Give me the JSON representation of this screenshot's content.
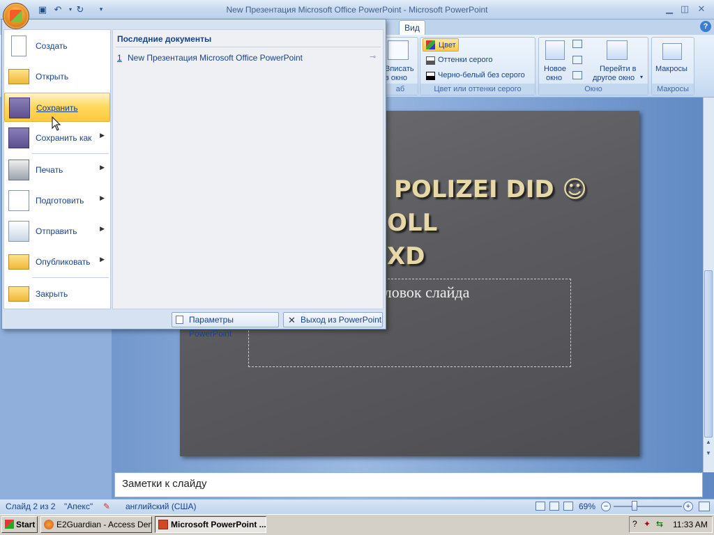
{
  "window": {
    "title": "New Презентация Microsoft Office PowerPoint - Microsoft PowerPoint"
  },
  "ribbon": {
    "tab_view": "Вид",
    "fit_window_line1": "Вписать",
    "fit_window_line2": "в окно",
    "scale_group_label": "аб",
    "color_button": "Цвет",
    "grayscale_button": "Оттенки серого",
    "bw_button": "Черно-белый без серого",
    "color_group_label": "Цвет или оттенки серого",
    "new_window_line1": "Новое",
    "new_window_line2": "окно",
    "switch_window_line1": "Перейти в",
    "switch_window_line2": "другое окно",
    "window_group_label": "Окно",
    "macros_button": "Макросы",
    "macros_group_label": "Макросы"
  },
  "menu": {
    "recent_header": "Последние документы",
    "recent_items": [
      {
        "number": "1",
        "name": "New Презентация Microsoft Office PowerPoint"
      }
    ],
    "items": [
      {
        "label": "Создать"
      },
      {
        "label": "Открыть"
      },
      {
        "label": "Сохранить"
      },
      {
        "label": "Сохранить как"
      },
      {
        "label": "Печать"
      },
      {
        "label": "Подготовить"
      },
      {
        "label": "Отправить"
      },
      {
        "label": "Опубликовать"
      },
      {
        "label": "Закрыть"
      }
    ],
    "options_button": "Параметры PowerPoint",
    "exit_button": "Выход из PowerPoint"
  },
  "slide": {
    "title_line1": "POLIZEI DID ☺",
    "title_line2": "OLL",
    "title_line3": "XD",
    "subtitle_placeholder": "оловок слайда"
  },
  "notes": {
    "placeholder": "Заметки к слайду"
  },
  "status": {
    "slide_counter": "Слайд 2 из 2",
    "theme": "\"Апекс\"",
    "language": "английский (США)",
    "zoom": "69%"
  },
  "taskbar": {
    "start": "Start",
    "tasks": [
      {
        "label": "E2Guardian - Access Den..."
      },
      {
        "label": "Microsoft PowerPoint ..."
      }
    ],
    "clock": "11:33 AM"
  },
  "colors": {
    "office_orange": "#e68a1c",
    "menu_hover": "#ffd75a",
    "ribbon_text": "#15428b"
  }
}
